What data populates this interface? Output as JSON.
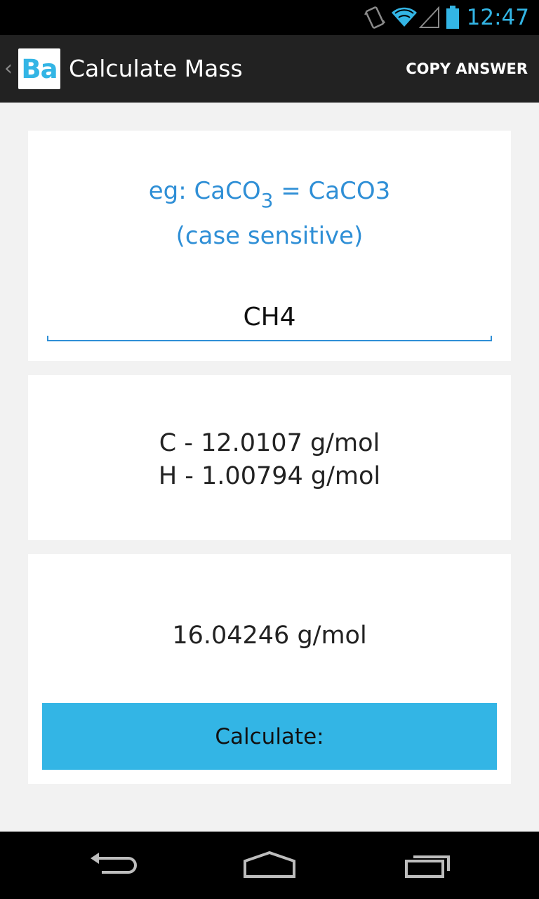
{
  "status_bar": {
    "time": "12:47",
    "icons": [
      "vibrate-icon",
      "wifi-icon",
      "signal-icon",
      "battery-icon"
    ],
    "accent_color": "#33b5e5"
  },
  "action_bar": {
    "app_icon_text": "Ba",
    "title": "Calculate Mass",
    "action_label": "COPY ANSWER"
  },
  "hint": {
    "prefix": "eg: CaCO",
    "subscript": "3",
    "suffix": " = CaCO3",
    "line2": "(case sensitive)",
    "color": "#2f8fd6"
  },
  "formula_input": {
    "value": "CH4"
  },
  "element_masses": [
    "C - 12.0107 g/mol",
    "H - 1.00794 g/mol"
  ],
  "result": "16.04246 g/mol",
  "calculate_button": {
    "label": "Calculate:",
    "color": "#33b5e5"
  },
  "nav_bar": {
    "icons": [
      "back-icon",
      "home-icon",
      "recents-icon"
    ]
  }
}
